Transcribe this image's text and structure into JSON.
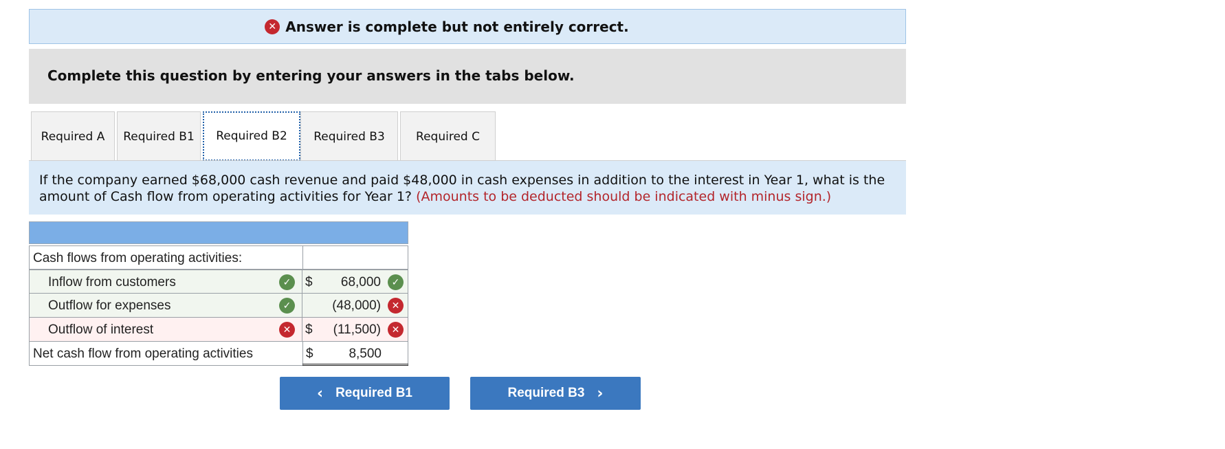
{
  "banner": {
    "text": "Answer is complete but not entirely correct.",
    "icon": "x-circle-icon"
  },
  "instructions": "Complete this question by entering your answers in the tabs below.",
  "tabs": [
    {
      "label": "Required A",
      "active": false
    },
    {
      "label": "Required B1",
      "active": false
    },
    {
      "label": "Required B2",
      "active": true
    },
    {
      "label": "Required B3",
      "active": false
    },
    {
      "label": "Required C",
      "active": false
    }
  ],
  "question": {
    "text": "If the company earned $68,000 cash revenue and paid $48,000 in cash expenses in addition to the interest in Year 1, what is the amount of Cash flow from operating activities for Year 1?",
    "note": "(Amounts to be deducted should be indicated with minus sign.)"
  },
  "table": {
    "rows": [
      {
        "label": "Cash flows from operating activities:",
        "label_status": "",
        "currency": "",
        "value": "",
        "value_status": ""
      },
      {
        "label": "Inflow from customers",
        "label_status": "correct",
        "currency": "$",
        "value": "68,000",
        "value_status": "correct"
      },
      {
        "label": "Outflow for expenses",
        "label_status": "correct",
        "currency": "",
        "value": "(48,000)",
        "value_status": "incorrect"
      },
      {
        "label": "Outflow of interest",
        "label_status": "incorrect",
        "currency": "$",
        "value": "(11,500)",
        "value_status": "incorrect"
      },
      {
        "label": "Net cash flow from operating activities",
        "label_status": "",
        "currency": "$",
        "value": "8,500",
        "value_status": ""
      }
    ]
  },
  "nav": {
    "prev_label": "Required B1",
    "next_label": "Required B3"
  },
  "colors": {
    "correct": "#5b8f4e",
    "incorrect": "#c4282f",
    "accent": "#3b78bf",
    "banner_bg": "#dbeaf8",
    "header_bg": "#7baee6",
    "note_red": "#b3252b"
  }
}
